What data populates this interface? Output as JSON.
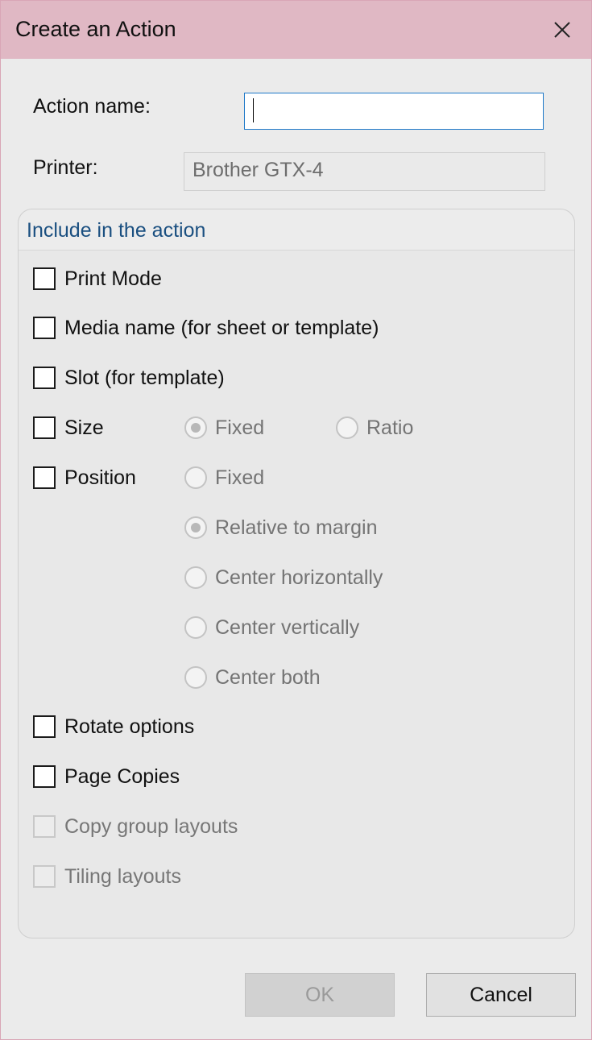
{
  "window": {
    "title": "Create an Action",
    "close_icon": "close-icon"
  },
  "form": {
    "action_name_label": "Action name:",
    "action_name_value": "",
    "printer_label": "Printer:",
    "printer_value": "Brother GTX-4"
  },
  "group": {
    "title": "Include in the action",
    "options": {
      "print_mode": {
        "label": "Print Mode",
        "checked": false,
        "enabled": true
      },
      "media_name": {
        "label": "Media name (for sheet or template)",
        "checked": false,
        "enabled": true
      },
      "slot": {
        "label": "Slot (for template)",
        "checked": false,
        "enabled": true
      },
      "size": {
        "label": "Size",
        "checked": false,
        "enabled": true
      },
      "position": {
        "label": "Position",
        "checked": false,
        "enabled": true
      },
      "rotate": {
        "label": "Rotate options",
        "checked": false,
        "enabled": true
      },
      "page_copies": {
        "label": "Page Copies",
        "checked": false,
        "enabled": true
      },
      "copy_group": {
        "label": "Copy group layouts",
        "checked": false,
        "enabled": false
      },
      "tiling": {
        "label": "Tiling layouts",
        "checked": false,
        "enabled": false
      }
    },
    "size_radios": {
      "fixed": {
        "label": "Fixed",
        "selected": true
      },
      "ratio": {
        "label": "Ratio",
        "selected": false
      }
    },
    "position_radios": {
      "fixed": {
        "label": "Fixed",
        "selected": false
      },
      "relative": {
        "label": "Relative to margin",
        "selected": true
      },
      "center_h": {
        "label": "Center horizontally",
        "selected": false
      },
      "center_v": {
        "label": "Center vertically",
        "selected": false
      },
      "center_both": {
        "label": "Center both",
        "selected": false
      }
    }
  },
  "buttons": {
    "ok": {
      "label": "OK",
      "enabled": false
    },
    "cancel": {
      "label": "Cancel",
      "enabled": true
    }
  },
  "colors": {
    "titlebar": "#e0b8c4",
    "accent": "#1e78c8",
    "group_title": "#1a4f80"
  }
}
